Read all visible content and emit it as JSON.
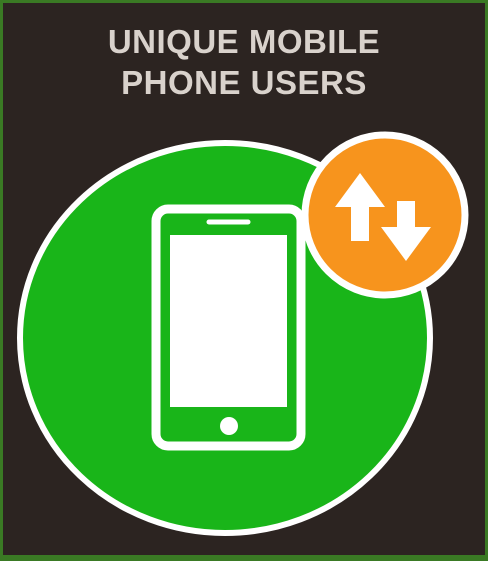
{
  "title": {
    "line1": "UNIQUE MOBILE",
    "line2": "PHONE USERS"
  },
  "icons": {
    "main": "smartphone-icon",
    "badge": "up-down-arrows-icon"
  },
  "colors": {
    "background": "#2c2421",
    "outer_border": "#3a7a24",
    "circle_fill": "#19b519",
    "circle_stroke": "#ffffff",
    "badge_fill": "#f7941d",
    "title_text": "#d9d2cc"
  }
}
